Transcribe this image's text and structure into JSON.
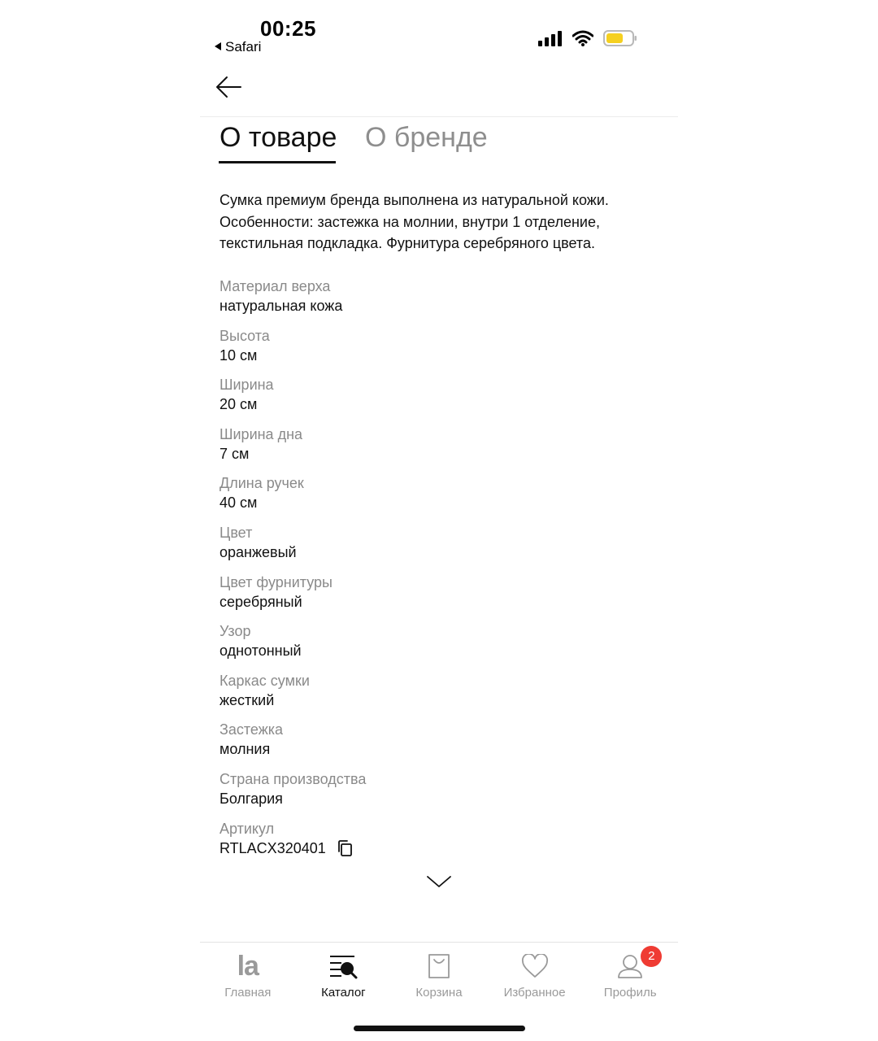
{
  "status_bar": {
    "time": "00:25",
    "back_app": "Safari"
  },
  "tabs": [
    {
      "label": "О товаре",
      "active": true
    },
    {
      "label": "О бренде",
      "active": false
    }
  ],
  "description": "Сумка премиум бренда выполнена из натуральной кожи. Особенности: застежка на молнии, внутри 1 отделение, текстильная подкладка. Фурнитура серебряного цвета.",
  "specs": [
    {
      "label": "Материал верха",
      "value": "натуральная кожа"
    },
    {
      "label": "Высота",
      "value": "10 см"
    },
    {
      "label": "Ширина",
      "value": "20 см"
    },
    {
      "label": "Ширина дна",
      "value": "7 см"
    },
    {
      "label": "Длина ручек",
      "value": "40 см"
    },
    {
      "label": "Цвет",
      "value": "оранжевый"
    },
    {
      "label": "Цвет фурнитуры",
      "value": "серебряный"
    },
    {
      "label": "Узор",
      "value": "однотонный"
    },
    {
      "label": "Каркас сумки",
      "value": "жесткий"
    },
    {
      "label": "Застежка",
      "value": "молния"
    },
    {
      "label": "Страна производства",
      "value": "Болгария"
    },
    {
      "label": "Артикул",
      "value": "RTLACX320401"
    }
  ],
  "bottom_nav": {
    "home": {
      "label": "Главная",
      "logo": "la"
    },
    "catalog": {
      "label": "Каталог"
    },
    "cart": {
      "label": "Корзина"
    },
    "favorites": {
      "label": "Избранное"
    },
    "profile": {
      "label": "Профиль",
      "badge": "2"
    }
  },
  "colors": {
    "accent": "#111111",
    "muted": "#8e8e8e",
    "badge": "#ef3b33",
    "battery": "#f5d020"
  }
}
